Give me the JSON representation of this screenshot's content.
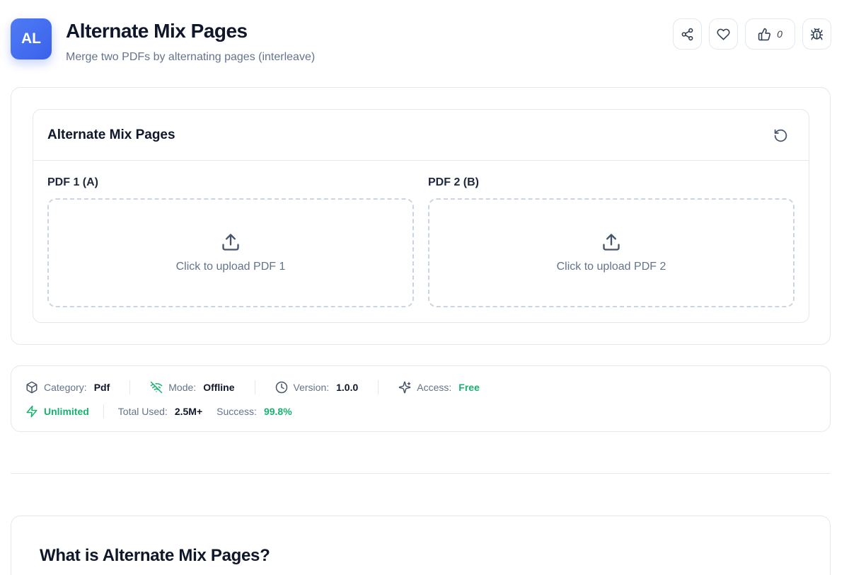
{
  "header": {
    "logo_text": "AL",
    "title": "Alternate Mix Pages",
    "subtitle": "Merge two PDFs by alternating pages (interleave)",
    "like_count": "0",
    "icons": [
      "share-icon",
      "heart-icon",
      "thumbs-up-icon",
      "bug-icon"
    ]
  },
  "tool": {
    "title": "Alternate Mix Pages",
    "pdf1": {
      "label": "PDF 1 (A)",
      "upload_text": "Click to upload PDF 1"
    },
    "pdf2": {
      "label": "PDF 2 (B)",
      "upload_text": "Click to upload PDF 2"
    }
  },
  "meta": {
    "category_key": "Category:",
    "category_val": "Pdf",
    "mode_key": "Mode:",
    "mode_val": "Offline",
    "version_key": "Version:",
    "version_val": "1.0.0",
    "access_key": "Access:",
    "access_val": "Free",
    "unlimited": "Unlimited",
    "total_key": "Total Used:",
    "total_val": "2.5M+",
    "success_key": "Success:",
    "success_val": "99.8%"
  },
  "about": {
    "title": "What is Alternate Mix Pages?"
  },
  "colors": {
    "accent": "#3a62ea",
    "green": "#16b36e",
    "border": "#e5e7eb",
    "muted": "#64748b"
  }
}
